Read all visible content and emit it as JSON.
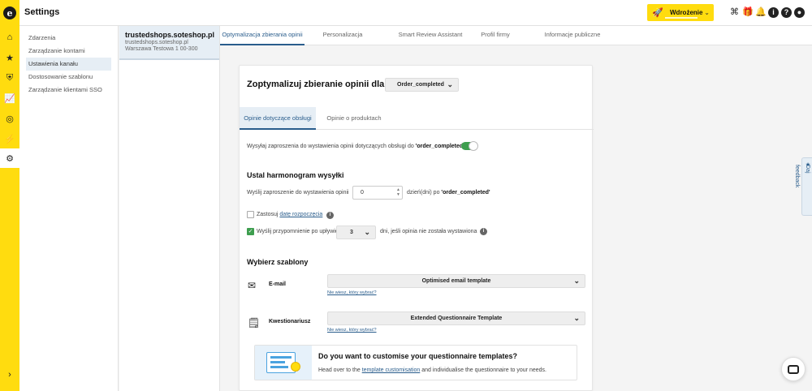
{
  "topbar": {
    "title": "Settings",
    "environment": "Wdrożenie",
    "icons": [
      "fingerprint-icon",
      "gift-icon",
      "bell-icon",
      "info-icon",
      "help-icon",
      "user-icon"
    ]
  },
  "rail": {
    "items": [
      "home-icon",
      "star-icon",
      "shield-icon",
      "chart-icon",
      "coin-icon",
      "plug-icon",
      "gear-icon"
    ],
    "active": "gear-icon"
  },
  "subnav": {
    "items": [
      {
        "label": "Zdarzenia"
      },
      {
        "label": "Zarządzanie kontami"
      },
      {
        "label": "Ustawienia kanału"
      },
      {
        "label": "Dostosowanie szablonu"
      },
      {
        "label": "Zarządzanie klientami SSO"
      }
    ],
    "active_index": 2
  },
  "shop": {
    "name": "trustedshops.soteshop.pl",
    "domain": "trustedshops.soteshop.pl",
    "address": "Warszawa Testowa 1 00-300"
  },
  "tabs": [
    {
      "label": "Optymalizacja zbierania opinii"
    },
    {
      "label": "Personalizacja"
    },
    {
      "label": "Smart Review Assistant"
    },
    {
      "label": "Profil firmy"
    },
    {
      "label": "Informacje publiczne"
    }
  ],
  "card": {
    "title": "Zoptymalizuj zbieranie opinii dla:",
    "event_select": "Order_completed",
    "inner_tabs": [
      {
        "label": "Opinie dotyczące obsługi"
      },
      {
        "label": "Opinie o produktach"
      }
    ],
    "invite_text_prefix": "Wysyłaj zaproszenia do wystawienia opinii dotyczących obsługi do ",
    "invite_text_event": "'order_completed'",
    "schedule": {
      "title": "Ustal harmonogram wysyłki",
      "send_label": "Wyślij zaproszenie do wystawienia opinii",
      "days_value": "0",
      "days_suffix_prefix": "dzień(dni) po ",
      "days_suffix_event": "'order_completed'",
      "apply_prefix": "Zastosuj ",
      "apply_link": "datę rozpoczęcia",
      "reminder_label": "Wyślij przypomnienie po upływie",
      "reminder_value": "3",
      "reminder_suffix": "dni, jeśli opinia nie została wystawiona"
    },
    "templates": {
      "title": "Wybierz szablony",
      "email_label": "E-mail",
      "email_value": "Optimised email template",
      "email_help": "Nie wiesz, który wybrać?",
      "questionnaire_label": "Kwestionariusz",
      "questionnaire_value": "Extended Questionnaire Template",
      "questionnaire_help": "Nie wiesz, który wybrać?"
    },
    "promo": {
      "title": "Do you want to customise your questionnaire templates?",
      "body_prefix": "Head over to the ",
      "body_link": "template customisation",
      "body_suffix": " and individualise the questionnaire to your needs."
    }
  },
  "feedback": {
    "label": "Daj feedback"
  },
  "colors": {
    "brand": "#ffdc0f",
    "accent": "#2a5d8c",
    "toggle_on": "#3e9e4f"
  }
}
